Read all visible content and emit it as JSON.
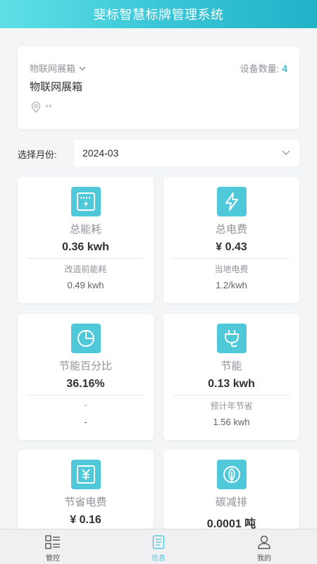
{
  "header": {
    "title": "斐标智慧标牌管理系统"
  },
  "device": {
    "type_label": "物联网展箱",
    "count_label": "设备数量:",
    "count_value": "4",
    "name": "物联网展箱",
    "location": "**"
  },
  "month": {
    "label": "选择月份:",
    "value": "2024-03"
  },
  "stats": [
    {
      "title": "总能耗",
      "value": "0.36 kwh",
      "sub_label": "改造前能耗",
      "sub_value": "0.49 kwh",
      "icon": "meter-icon"
    },
    {
      "title": "总电费",
      "value": "¥ 0.43",
      "sub_label": "当地电费",
      "sub_value": "1.2/kwh",
      "icon": "lightning-icon"
    },
    {
      "title": "节能百分比",
      "value": "36.16%",
      "sub_label": "-",
      "sub_value": "-",
      "icon": "pie-chart-icon"
    },
    {
      "title": "节能",
      "value": "0.13 kwh",
      "sub_label": "预计年节省",
      "sub_value": "1.56 kwh",
      "icon": "plug-icon"
    },
    {
      "title": "节省电费",
      "value": "¥ 0.16",
      "icon": "yen-icon"
    },
    {
      "title": "碳减排",
      "value": "0.0001 吨",
      "icon": "leaf-icon"
    }
  ],
  "tabs": [
    {
      "label": "管控",
      "icon": "control-icon",
      "active": false
    },
    {
      "label": "信息",
      "icon": "document-icon",
      "active": true
    },
    {
      "label": "我的",
      "icon": "user-icon",
      "active": false
    }
  ],
  "colors": {
    "accent": "#4fc9d9",
    "header_start": "#5ee0e6",
    "header_end": "#22b2c8"
  }
}
